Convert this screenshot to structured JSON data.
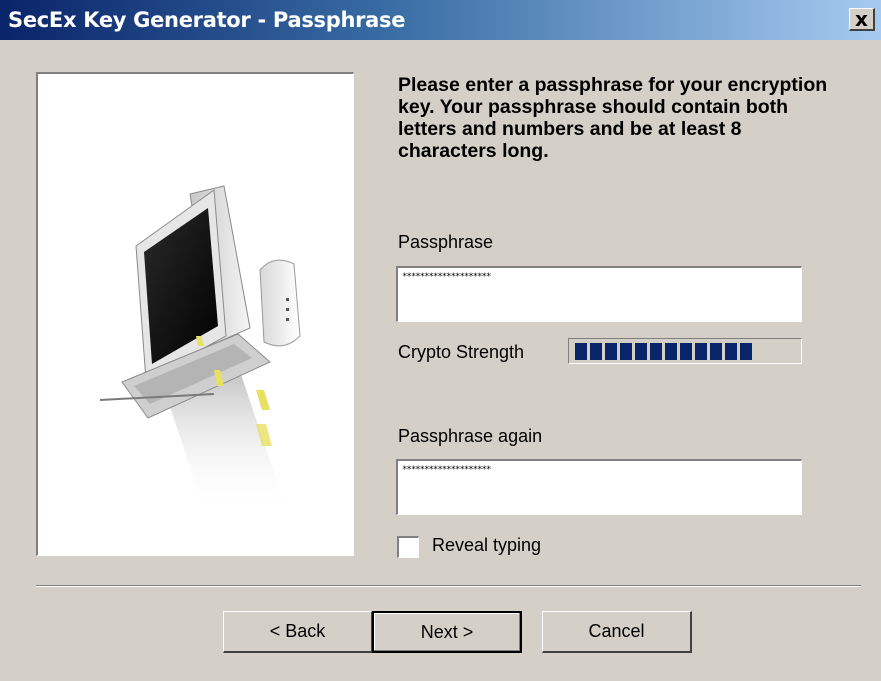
{
  "window": {
    "title": "SecEx Key Generator - Passphrase",
    "close_glyph": "x"
  },
  "instructions": "Please enter a passphrase for your encryption key. Your passphrase should contain both letters and numbers and be at least 8 characters long.",
  "passphrase": {
    "label": "Passphrase",
    "masked_value": "********************"
  },
  "crypto_strength": {
    "label": "Crypto Strength",
    "filled_segments": 12,
    "bar_color": "#0a246a"
  },
  "passphrase_again": {
    "label": "Passphrase again",
    "masked_value": "********************"
  },
  "reveal_typing": {
    "label": "Reveal typing",
    "checked": false
  },
  "buttons": {
    "back": "< Back",
    "next": "Next >",
    "cancel": "Cancel"
  },
  "colors": {
    "dialog_bg": "#d4d0c8",
    "titlebar_start": "#0a246a",
    "titlebar_end": "#a6caf0"
  },
  "illustration": {
    "icon": "computer-with-keyboard-and-speaker-icon"
  }
}
